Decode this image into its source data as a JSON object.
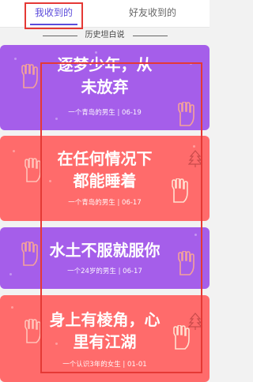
{
  "tabs": {
    "received": "我收到的",
    "friends": "好友收到的"
  },
  "section": {
    "title": "历史坦白说"
  },
  "cards": [
    {
      "title_line1": "逐梦少年，从",
      "title_line2": "未放弃",
      "meta": "一个青岛的男生 | 06-19",
      "color": "#a55eea"
    },
    {
      "title_line1": "在任何情况下",
      "title_line2": "都能睡着",
      "meta": "一个青岛的男生 | 06-17",
      "color": "#ff6b6b"
    },
    {
      "title_line1": "水土不服就服你",
      "title_line2": "",
      "meta": "一个24岁的男生 | 06-17",
      "color": "#a55eea"
    },
    {
      "title_line1": "身上有棱角，心",
      "title_line2": "里有江湖",
      "meta": "一个认识3年的女生 | 01-01",
      "color": "#ff6b6b"
    }
  ],
  "colors": {
    "purple_card": "#a55eea",
    "red_card": "#ff6b6b",
    "tab_active": "#5b4bdb",
    "annotation_red": "#e53935"
  }
}
